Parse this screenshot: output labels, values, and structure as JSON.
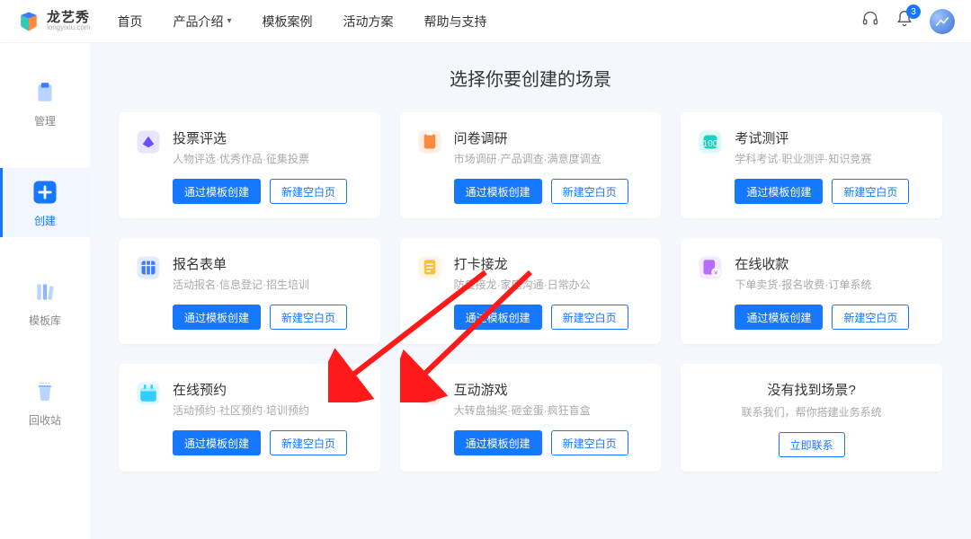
{
  "brand": {
    "zh": "龙艺秀",
    "en": "longyixiu.com"
  },
  "topnav": {
    "items": [
      "首页",
      "产品介绍",
      "模板案例",
      "活动方案",
      "帮助与支持"
    ],
    "badge": "3"
  },
  "sidebar": {
    "items": [
      {
        "label": "管理"
      },
      {
        "label": "创建"
      },
      {
        "label": "模板库"
      },
      {
        "label": "回收站"
      }
    ]
  },
  "main": {
    "title": "选择你要创建的场景",
    "btn_primary": "通过模板创建",
    "btn_outline": "新建空白页",
    "cards": [
      {
        "title": "投票评选",
        "sub": "人物评选·优秀作品·征集投票",
        "color": "#6b4cff"
      },
      {
        "title": "问卷调研",
        "sub": "市场调研·产品调查·满意度调查",
        "color": "#ff8a3d"
      },
      {
        "title": "考试测评",
        "sub": "学科考试·职业测评·知识竞赛",
        "color": "#18d2c4"
      },
      {
        "title": "报名表单",
        "sub": "活动报名·信息登记·招生培训",
        "color": "#3d7bff"
      },
      {
        "title": "打卡接龙",
        "sub": "防疫接龙·家庭沟通·日常办公",
        "color": "#ffbf3d"
      },
      {
        "title": "在线收款",
        "sub": "下单卖货·报名收费·订单系统",
        "color": "#b96bff"
      },
      {
        "title": "在线预约",
        "sub": "活动预约·社区预约·培训预约",
        "color": "#2fd0ff"
      },
      {
        "title": "互动游戏",
        "sub": "大转盘抽奖·砸金蛋·疯狂盲盒",
        "color": "#ff6b6b"
      }
    ],
    "cta": {
      "title": "没有找到场景?",
      "sub": "联系我们，帮你搭建业务系统",
      "btn": "立即联系"
    }
  }
}
